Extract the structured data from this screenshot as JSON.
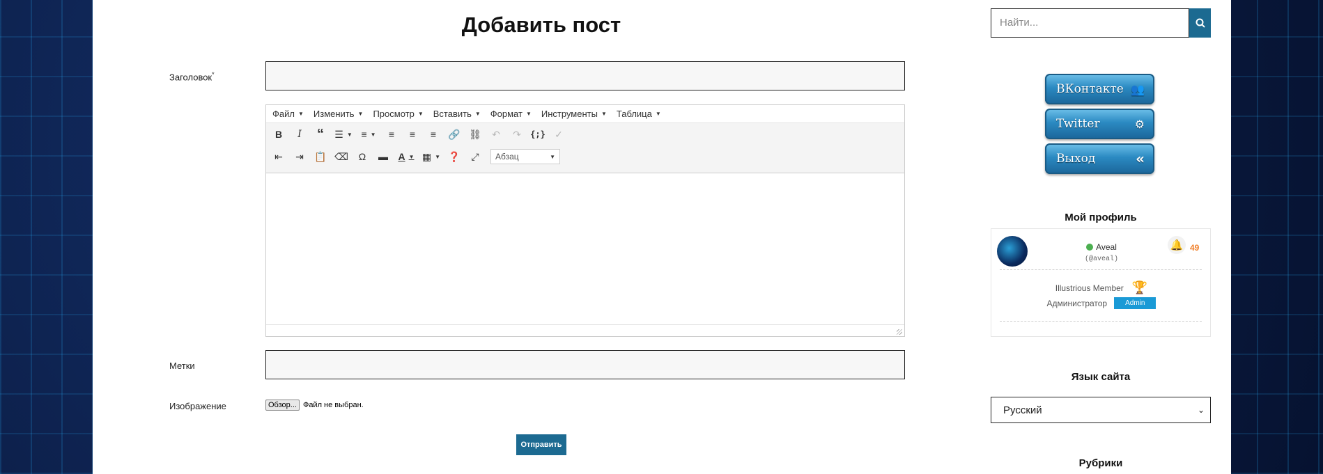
{
  "page_title": "Добавить пост",
  "form": {
    "title_label": "Заголовок",
    "title_required_mark": "*",
    "tags_label": "Метки",
    "image_label": "Изображение",
    "file_button": "Обзор...",
    "file_status": "Файл не выбран.",
    "submit_label": "Отправить"
  },
  "editor": {
    "menu": [
      "Файл",
      "Изменить",
      "Просмотр",
      "Вставить",
      "Формат",
      "Инструменты",
      "Таблица"
    ],
    "format_select": "Абзац"
  },
  "sidebar": {
    "search_placeholder": "Найти...",
    "social": {
      "vk": "ВКонтакте",
      "twitter": "Twitter",
      "logout": "Выход"
    },
    "profile_heading": "Мой профиль",
    "profile": {
      "name": "Aveal",
      "handle": "(@aveal)",
      "notifications": "49",
      "rank": "Illustrious Member",
      "role": "Администратор",
      "role_badge": "Admin",
      "online_color": "#4caf50"
    },
    "language_heading": "Язык сайта",
    "language_value": "Русский",
    "categories_heading": "Рубрики"
  },
  "colors": {
    "accent": "#1c6a91",
    "notification": "#f07f2a",
    "admin_badge": "#1a9ad6"
  }
}
